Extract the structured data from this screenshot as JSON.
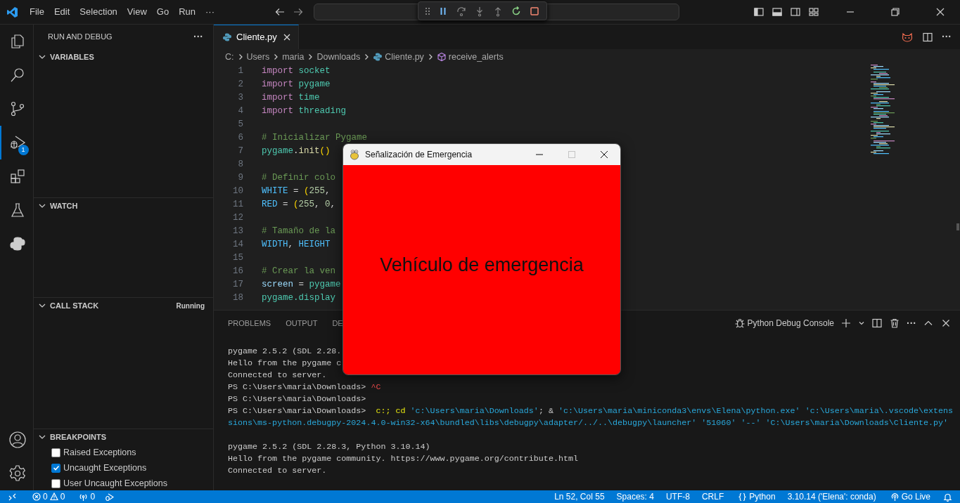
{
  "title_bar": {
    "menus": [
      "File",
      "Edit",
      "Selection",
      "View",
      "Go",
      "Run",
      "···"
    ]
  },
  "activity_bar": {
    "items": [
      {
        "kind": "files",
        "selected": false
      },
      {
        "kind": "search",
        "selected": false
      },
      {
        "kind": "branch",
        "selected": false
      },
      {
        "kind": "debug",
        "selected": true,
        "badge": "1"
      },
      {
        "kind": "blocks",
        "selected": false
      },
      {
        "kind": "flask",
        "selected": false
      },
      {
        "kind": "python",
        "selected": false
      }
    ]
  },
  "sidebar": {
    "title": "RUN AND DEBUG",
    "more": "···",
    "sections": [
      {
        "label": "VARIABLES",
        "expanded": true
      },
      {
        "label": "WATCH",
        "expanded": true
      },
      {
        "label": "CALL STACK",
        "expanded": true,
        "status": "Running"
      },
      {
        "label": "BREAKPOINTS",
        "expanded": true,
        "items": [
          {
            "label": "Raised Exceptions",
            "checked": false
          },
          {
            "label": "Uncaught Exceptions",
            "checked": true
          },
          {
            "label": "User Uncaught Exceptions",
            "checked": false
          }
        ]
      }
    ]
  },
  "editor": {
    "more": "···",
    "tabs": [
      {
        "label": "Cliente.py",
        "selected": true
      }
    ],
    "breadcrumb": [
      {
        "kind": "folder",
        "text": "C:"
      },
      {
        "kind": "folder",
        "text": "Users"
      },
      {
        "kind": "folder",
        "text": "maria"
      },
      {
        "kind": "folder",
        "text": "Downloads"
      },
      {
        "kind": "file",
        "text": "Cliente.py"
      },
      {
        "kind": "symbol",
        "text": "receive_alerts"
      }
    ],
    "lines": [
      {
        "number": "1",
        "tokens": [
          {
            "kind": "keyword",
            "text": "import "
          },
          {
            "kind": "module",
            "text": "socket"
          }
        ]
      },
      {
        "number": "2",
        "tokens": [
          {
            "kind": "keyword",
            "text": "import "
          },
          {
            "kind": "module",
            "text": "pygame"
          }
        ]
      },
      {
        "number": "3",
        "tokens": [
          {
            "kind": "keyword",
            "text": "import "
          },
          {
            "kind": "module",
            "text": "time"
          }
        ]
      },
      {
        "number": "4",
        "tokens": [
          {
            "kind": "keyword",
            "text": "import "
          },
          {
            "kind": "module",
            "text": "threading"
          }
        ]
      },
      {
        "number": "5"
      },
      {
        "number": "6",
        "tokens": [
          {
            "kind": "comment",
            "text": "# Inicializar Pygame"
          }
        ]
      },
      {
        "number": "7",
        "tokens": [
          {
            "kind": "module",
            "text": "pygame"
          },
          {
            "kind": "op",
            "text": "."
          },
          {
            "kind": "func",
            "text": "init"
          },
          {
            "kind": "paren",
            "text": "()"
          }
        ]
      },
      {
        "number": "8"
      },
      {
        "number": "9",
        "tokens": [
          {
            "kind": "comment",
            "text": "# Definir colo"
          }
        ]
      },
      {
        "number": "10",
        "tokens": [
          {
            "kind": "const",
            "text": "WHITE"
          },
          {
            "kind": "op",
            "text": " = "
          },
          {
            "kind": "paren",
            "text": "("
          },
          {
            "kind": "number",
            "text": "255"
          },
          {
            "kind": "op",
            "text": ", "
          }
        ]
      },
      {
        "number": "11",
        "tokens": [
          {
            "kind": "const",
            "text": "RED"
          },
          {
            "kind": "op",
            "text": " = "
          },
          {
            "kind": "paren",
            "text": "("
          },
          {
            "kind": "number",
            "text": "255"
          },
          {
            "kind": "op",
            "text": ", "
          },
          {
            "kind": "number",
            "text": "0"
          },
          {
            "kind": "op",
            "text": ","
          }
        ]
      },
      {
        "number": "12"
      },
      {
        "number": "13",
        "tokens": [
          {
            "kind": "comment",
            "text": "# Tamaño de la"
          }
        ]
      },
      {
        "number": "14",
        "tokens": [
          {
            "kind": "const",
            "text": "WIDTH"
          },
          {
            "kind": "op",
            "text": ", "
          },
          {
            "kind": "const",
            "text": "HEIGHT"
          }
        ]
      },
      {
        "number": "15"
      },
      {
        "number": "16",
        "tokens": [
          {
            "kind": "comment",
            "text": "# Crear la ven"
          }
        ]
      },
      {
        "number": "17",
        "tokens": [
          {
            "kind": "var",
            "text": "screen"
          },
          {
            "kind": "op",
            "text": " = "
          },
          {
            "kind": "module",
            "text": "pygame"
          }
        ]
      },
      {
        "number": "18",
        "tokens": [
          {
            "kind": "module",
            "text": "pygame.display"
          }
        ]
      }
    ]
  },
  "panel": {
    "tabs": [
      {
        "label": "PROBLEMS",
        "selected": false
      },
      {
        "label": "OUTPUT",
        "selected": false
      },
      {
        "label": "DE",
        "selected": false
      }
    ],
    "console_name": "Python Debug Console",
    "more": "···",
    "terminal_lines": [
      {
        "tokens": [
          {
            "kind": "plain",
            "text": "pygame 2.5.2 (SDL 2.28."
          }
        ]
      },
      {
        "tokens": [
          {
            "kind": "plain",
            "text": "Hello from the pygame c"
          }
        ]
      },
      {
        "tokens": [
          {
            "kind": "plain",
            "text": "Connected to server."
          }
        ]
      },
      {
        "tokens": [
          {
            "kind": "plain",
            "text": "PS C:\\Users\\maria\\Downloads> "
          },
          {
            "kind": "error",
            "text": "^C"
          }
        ]
      },
      {
        "tokens": [
          {
            "kind": "plain",
            "text": "PS C:\\Users\\maria\\Downloads>"
          }
        ]
      },
      {
        "tokens": [
          {
            "kind": "plain",
            "text": "PS C:\\Users\\maria\\Downloads>  "
          },
          {
            "kind": "command",
            "text": "c:; cd "
          },
          {
            "kind": "string",
            "text": "'c:\\Users\\maria\\Downloads'"
          },
          {
            "kind": "plain",
            "text": "; & "
          },
          {
            "kind": "string",
            "text": "'c:\\Users\\maria\\miniconda3\\envs\\Elena\\python.exe' 'c:\\Users\\maria\\.vscode\\extens"
          }
        ]
      },
      {
        "tokens": [
          {
            "kind": "string",
            "text": "sions\\ms-python.debugpy-2024.4.0-win32-x64\\bundled\\libs\\debugpy\\adapter/../..\\debugpy\\launcher' '51060' '--' 'C:\\Users\\maria\\Downloads\\Cliente.py'"
          }
        ]
      },
      {
        "blank_before": true,
        "tokens": [
          {
            "kind": "plain",
            "text": "pygame 2.5.2 (SDL 2.28.3, Python 3.10.14)"
          }
        ]
      },
      {
        "tokens": [
          {
            "kind": "plain",
            "text": "Hello from the pygame community. https://www.pygame.org/contribute.html"
          }
        ]
      },
      {
        "tokens": [
          {
            "kind": "plain",
            "text": "Connected to server."
          }
        ]
      }
    ]
  },
  "status_bar": {
    "errors": "0",
    "warnings": "0",
    "ports": "0",
    "items": [
      {
        "kind": "text",
        "text": "Ln 52, Col 55"
      },
      {
        "kind": "text",
        "text": "Spaces: 4"
      },
      {
        "kind": "text",
        "text": "UTF-8"
      },
      {
        "kind": "text",
        "text": "CRLF"
      },
      {
        "kind": "language",
        "text": "Python"
      },
      {
        "kind": "text",
        "text": "3.10.14 ('Elena': conda)"
      },
      {
        "kind": "live",
        "text": "Go Live"
      }
    ]
  },
  "popup_window": {
    "title": "Señalización de Emergencia",
    "message": "Vehículo de emergencia",
    "maximize_disabled": true
  }
}
